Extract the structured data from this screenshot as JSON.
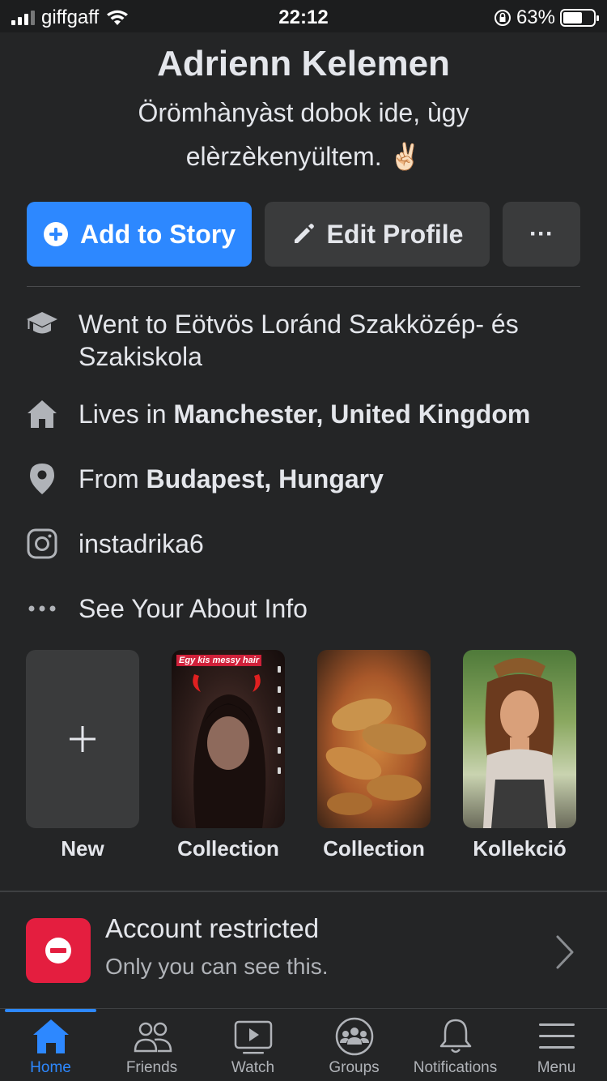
{
  "status_bar": {
    "carrier": "giffgaff",
    "time": "22:12",
    "battery": "63%",
    "battery_fraction": 0.63
  },
  "profile": {
    "name": "Adrienn Kelemen",
    "bio_line1": "Örömhànyàst dobok ide, ùgy",
    "bio_line2": "elèrzèkenyültem. ✌🏻"
  },
  "actions": {
    "add_story": "Add to Story",
    "edit_profile": "Edit Profile",
    "more": "···"
  },
  "info": {
    "education_prefix": "Went to ",
    "education": "Eötvös Loránd Szakközép- és Szakiskola",
    "lives_prefix": "Lives in ",
    "lives": "Manchester, United Kingdom",
    "from_prefix": "From ",
    "from": "Budapest, Hungary",
    "instagram": "instadrika6",
    "about": "See Your About Info"
  },
  "highlights": [
    {
      "label": "New"
    },
    {
      "label": "Collection",
      "overlay_text": "Egy kis messy hair"
    },
    {
      "label": "Collection"
    },
    {
      "label": "Kollekció"
    }
  ],
  "restricted": {
    "title": "Account restricted",
    "subtitle": "Only you can see this."
  },
  "tabs": {
    "home": "Home",
    "friends": "Friends",
    "watch": "Watch",
    "groups": "Groups",
    "notifications": "Notifications",
    "menu": "Menu"
  },
  "colors": {
    "background": "#242526",
    "accent": "#2d88ff",
    "restricted": "#e41e3f"
  }
}
